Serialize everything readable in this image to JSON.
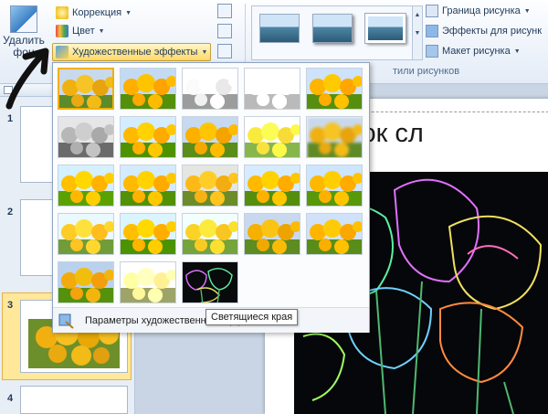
{
  "ribbon": {
    "remove_bg_label": "Удалить фон",
    "correction_label": "Коррекция",
    "color_label": "Цвет",
    "art_effects_label": "Художественные эффекты",
    "border_label": "Граница рисунка",
    "effects_label": "Эффекты для рисунк",
    "layout_label": "Макет рисунка",
    "styles_group_label": "тили рисунков"
  },
  "panel": {
    "slides": [
      {
        "number": "1"
      },
      {
        "number": "2"
      },
      {
        "number": "3"
      },
      {
        "number": "4"
      }
    ]
  },
  "slide": {
    "title": "Заголовок сл"
  },
  "artistic_menu": {
    "effects": [
      {
        "name": "none",
        "filter": "none"
      },
      {
        "name": "marker",
        "filter": "saturate(1.4)"
      },
      {
        "name": "pencil-grayscale",
        "filter": "grayscale(1) contrast(1.3) brightness(1.3)"
      },
      {
        "name": "pencil-sketch",
        "filter": "grayscale(1) contrast(2) brightness(1.6)"
      },
      {
        "name": "line-drawing",
        "filter": "saturate(1.2) contrast(1.1)"
      },
      {
        "name": "chalk-sketch",
        "filter": "grayscale(1) contrast(1.5) brightness(0.9)"
      },
      {
        "name": "paint-strokes",
        "filter": "saturate(1.3) contrast(1.2)"
      },
      {
        "name": "paint-brush",
        "filter": "saturate(1.2)"
      },
      {
        "name": "light-screen",
        "filter": "brightness(1.35) saturate(0.8)"
      },
      {
        "name": "blur",
        "filter": "blur(1.5px)"
      },
      {
        "name": "mosaic-bubbles",
        "filter": "saturate(1.5) brightness(1.1)"
      },
      {
        "name": "glass",
        "filter": "saturate(1.2) contrast(1.2)"
      },
      {
        "name": "cement",
        "filter": "sepia(0.3) saturate(1.3)"
      },
      {
        "name": "texturizer",
        "filter": "contrast(1.2) saturate(1.1)"
      },
      {
        "name": "crisscross-etching",
        "filter": "saturate(1.4) brightness(1.05)"
      },
      {
        "name": "pastels-smooth",
        "filter": "saturate(0.9) brightness(1.15)"
      },
      {
        "name": "plastic-wrap",
        "filter": "saturate(1.3) contrast(1.3)"
      },
      {
        "name": "cutout",
        "filter": "brightness(1.2) saturate(0.9)"
      },
      {
        "name": "photocopy",
        "filter": "saturate(1.1)"
      },
      {
        "name": "film-grain",
        "filter": "saturate(1.1) contrast(1.1)"
      },
      {
        "name": "watercolor-sponge",
        "filter": "saturate(1.6) contrast(0.9)"
      },
      {
        "name": "crumpled",
        "filter": "grayscale(0.6) sepia(0.4) contrast(1.4) brightness(1.2)"
      },
      {
        "name": "glow-edges",
        "filter": "invert(0)"
      }
    ],
    "footer_label": "Параметры художественных эффектов...",
    "tooltip": "Светящиеся края"
  },
  "colors": {
    "accent_hover": "#ffe9a8",
    "selected_border": "#f2b000",
    "ribbon_bg": "#e4ecf7"
  }
}
